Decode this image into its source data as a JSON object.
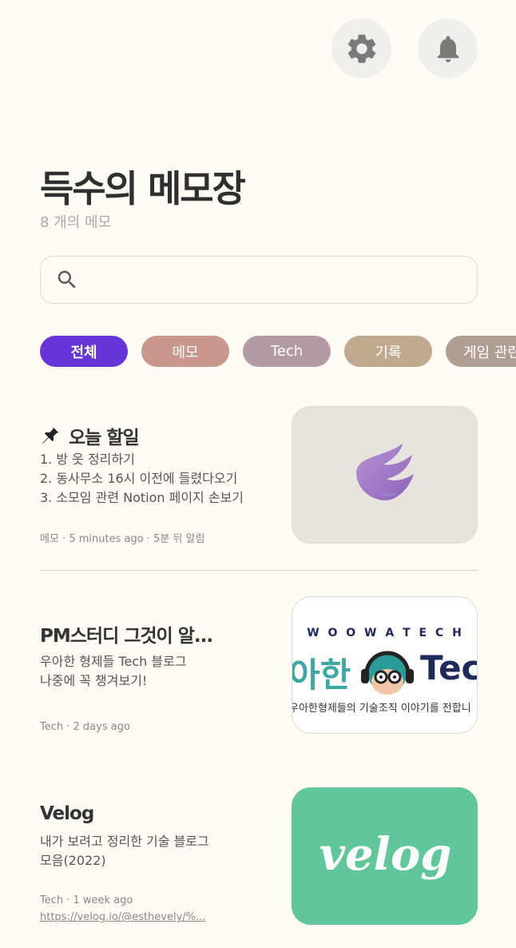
{
  "header": {
    "settings_icon": "gear-icon",
    "notification_icon": "bell-icon",
    "title": "득수의 메모장",
    "memo_count": "8 개의 메모"
  },
  "search": {
    "placeholder": "",
    "icon": "search-icon"
  },
  "categories": [
    {
      "label": "전체",
      "color": "#6535d8",
      "active": true
    },
    {
      "label": "메모",
      "color": "#c9978c",
      "active": false
    },
    {
      "label": "Tech",
      "color": "#b39ba6",
      "active": false
    },
    {
      "label": "기록",
      "color": "#c1a98f",
      "active": false
    },
    {
      "label": "게임 관련",
      "color": "#b09e94",
      "active": false
    }
  ],
  "memos": [
    {
      "pinned": true,
      "title": "오늘 할일",
      "body": [
        "1. 방 옷 정리하기",
        "2. 동사무소 16시 이전에 들렸다오기",
        "3. 소모임 관련 Notion 페이지 손보기"
      ],
      "meta": "메모 · 5 minutes ago ·  5분 뒤 알림",
      "thumbnail": "purple-wing-logo"
    },
    {
      "pinned": false,
      "title": "PM스터디 그것이 알...",
      "body": [
        "우아한 형제들 Tech 블로그",
        "나중에 꼭 챙겨보기!"
      ],
      "meta": "Tech · 2 days ago",
      "thumbnail": {
        "brand": "W O O W A T E C H",
        "left_text": "아한",
        "right_text": "Tec",
        "caption": "우아한형제들의 기술조직 이야기를 전합니"
      }
    },
    {
      "pinned": false,
      "title": "Velog",
      "body": [
        "내가 보려고 정리한 기술 블로그",
        "모음(2022)"
      ],
      "meta": "Tech · 1 week ago",
      "link": "https://velog.io/@esthevely/%...",
      "thumbnail": {
        "text": "velog",
        "color": "#5fc79a"
      }
    }
  ]
}
